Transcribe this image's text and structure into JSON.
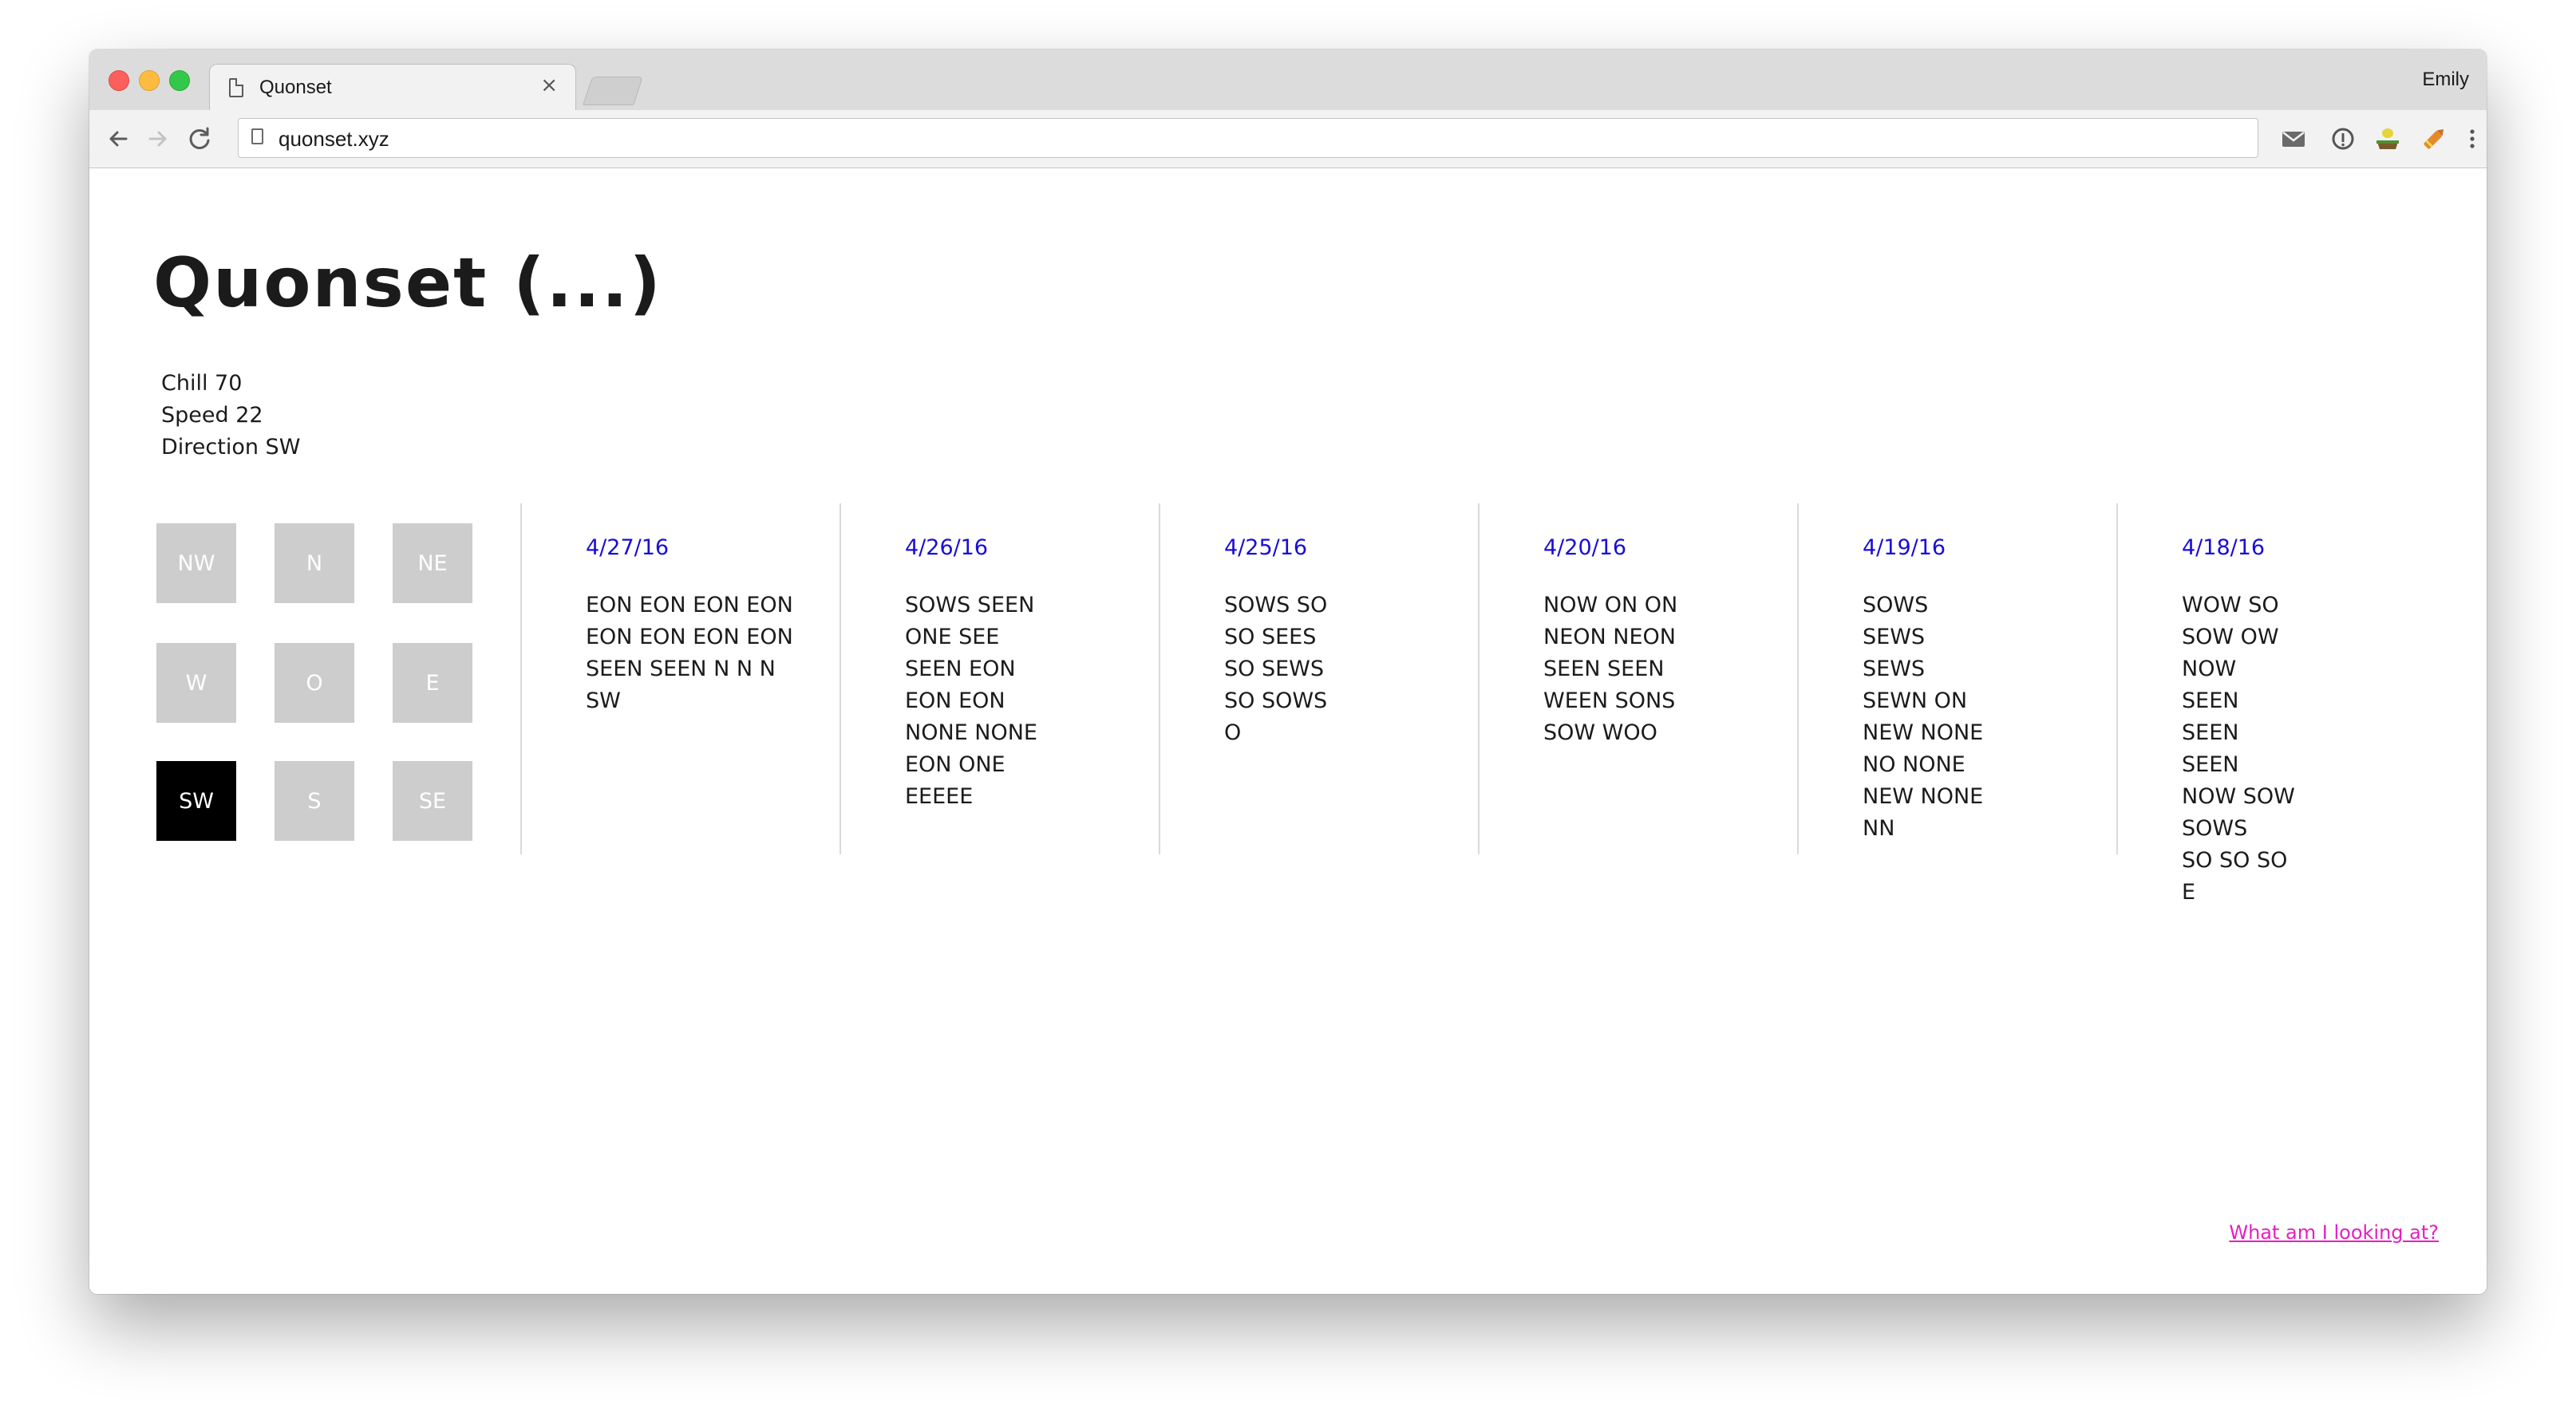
{
  "browser": {
    "tab_title": "Quonset",
    "tab_close": "×",
    "profile_name": "Emily",
    "url": "quonset.xyz"
  },
  "page": {
    "title": "Quonset (...)",
    "stats": [
      "Chill 70",
      "Speed 22",
      "Direction SW"
    ],
    "compass": {
      "labels": [
        "NW",
        "N",
        "NE",
        "W",
        "O",
        "E",
        "SW",
        "S",
        "SE"
      ],
      "active": "SW"
    },
    "columns": [
      {
        "date": "4/27/16",
        "lines": [
          "EON EON EON EON",
          "EON EON EON EON",
          "SEEN SEEN N N N",
          "SW"
        ]
      },
      {
        "date": "4/26/16",
        "lines": [
          "SOWS SEEN",
          "ONE SEE",
          "SEEN EON",
          "EON EON",
          "NONE NONE",
          "EON ONE",
          "EEEEE"
        ]
      },
      {
        "date": "4/25/16",
        "lines": [
          "SOWS SO",
          "SO SEES",
          "SO SEWS",
          "SO SOWS",
          "O"
        ]
      },
      {
        "date": "4/20/16",
        "lines": [
          "NOW ON ON",
          "NEON NEON",
          "SEEN SEEN",
          "WEEN SONS",
          "SOW WOO"
        ]
      },
      {
        "date": "4/19/16",
        "lines": [
          "SOWS",
          "SEWS",
          "SEWS",
          "SEWN ON",
          "NEW NONE",
          "NO NONE",
          "NEW NONE",
          "NN"
        ]
      },
      {
        "date": "4/18/16",
        "lines": [
          "WOW SO",
          "SOW OW",
          "NOW",
          "SEEN",
          "SEEN",
          "SEEN",
          "NOW SOW",
          "SOWS",
          "SO SO SO",
          "E"
        ]
      }
    ],
    "help_link": "What am I looking at?"
  },
  "colors": {
    "date_link": "#1a0dd6",
    "help_link": "#e41fc4",
    "direction_inactive": "#cdcdcd",
    "direction_active": "#000000"
  },
  "icons": [
    "page-icon",
    "back-arrow-icon",
    "forward-arrow-icon",
    "reload-icon",
    "mail-icon",
    "info-icon",
    "plant-icon",
    "pencil-icon",
    "kebab-menu-icon"
  ]
}
